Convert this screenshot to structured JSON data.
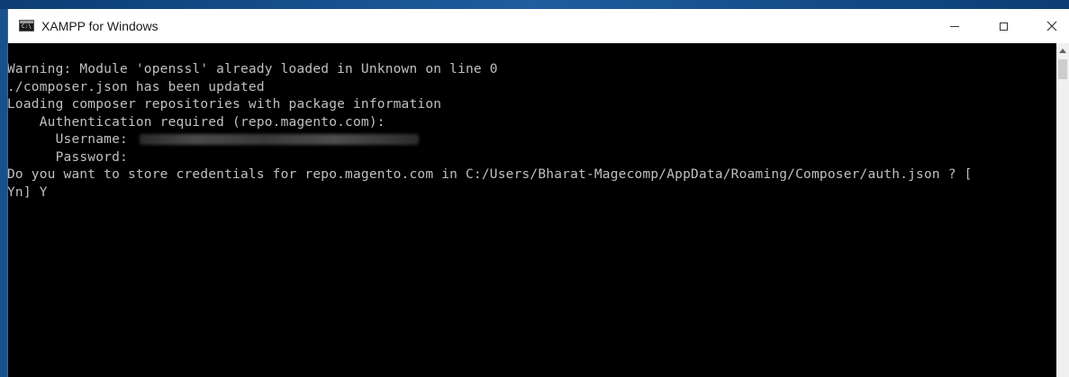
{
  "window": {
    "title": "XAMPP for Windows",
    "icon": "console-icon",
    "icon_prompt": "C:\\",
    "controls": {
      "minimize": "minimize-icon",
      "maximize": "maximize-icon",
      "close_glyph": "✕"
    }
  },
  "console": {
    "lines": [
      "Warning: Module 'openssl' already loaded in Unknown on line 0",
      "./composer.json has been updated",
      "Loading composer repositories with package information",
      "    Authentication required (repo.magento.com):",
      "      Username: ",
      "      Password: ",
      "Do you want to store credentials for repo.magento.com in C:/Users/Bharat-Magecomp/AppData/Roaming/Composer/auth.json ? [",
      "Yn] Y"
    ],
    "username_redacted": true
  },
  "colors": {
    "console_bg": "#000000",
    "console_text": "#c0c0c0",
    "titlebar_bg": "#ffffff",
    "close_hover": "#e81123"
  }
}
